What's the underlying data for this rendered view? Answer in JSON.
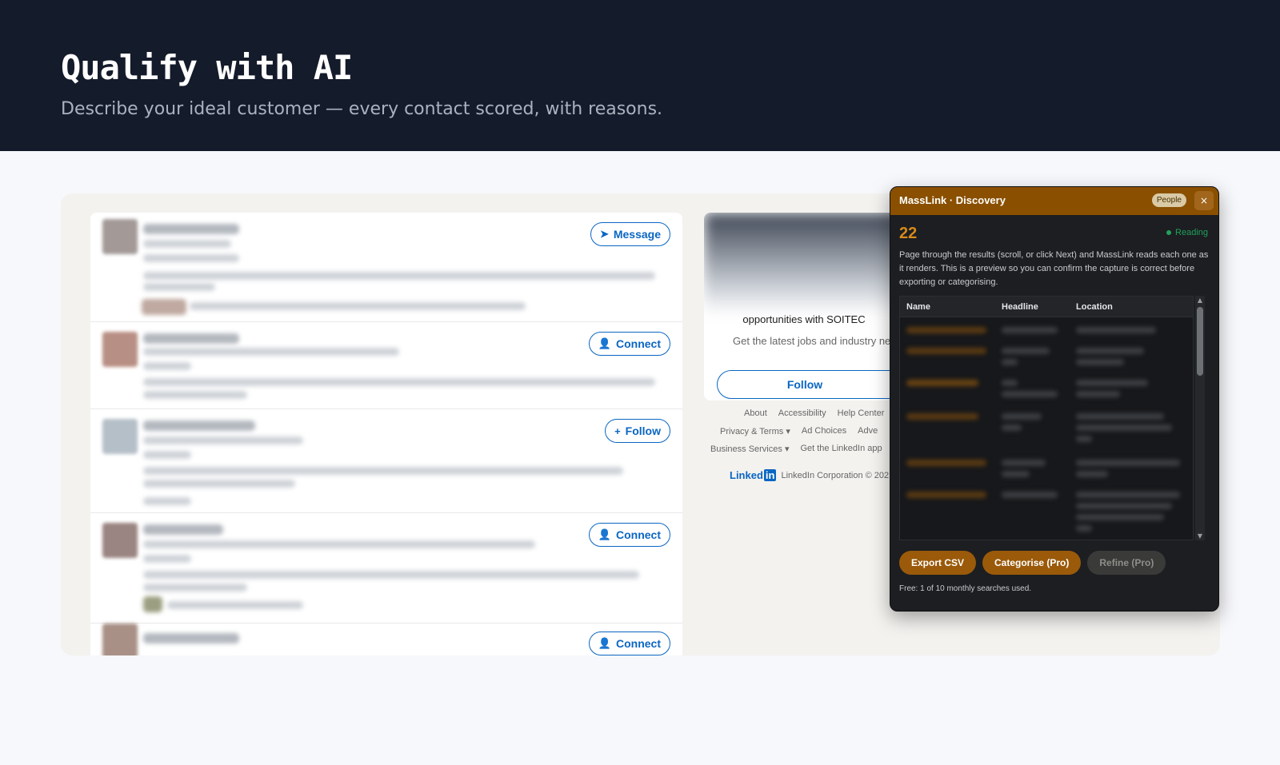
{
  "hero": {
    "title": "Qualify with AI",
    "subtitle": "Describe your ideal customer — every contact scored, with reasons."
  },
  "feed": {
    "rows": [
      {
        "action_label": "Message",
        "action_icon": "send-icon"
      },
      {
        "action_label": "Connect",
        "action_icon": "add-person-icon"
      },
      {
        "action_label": "Follow",
        "action_icon": "plus-icon"
      },
      {
        "action_label": "Connect",
        "action_icon": "add-person-icon"
      },
      {
        "action_label": "Connect",
        "action_icon": "add-person-icon"
      }
    ]
  },
  "company_card": {
    "headline": "opportunities with SOITEC",
    "tagline": "Get the latest jobs and industry ne",
    "follow_label": "Follow"
  },
  "footer": {
    "links_row1": [
      "About",
      "Accessibility",
      "Help Center"
    ],
    "links_row2": [
      "Privacy & Terms",
      "Ad Choices",
      "Adve"
    ],
    "links_row3": [
      "Business Services",
      "Get the LinkedIn app"
    ],
    "logo_text": "Linked",
    "logo_box": "in",
    "copyright": "LinkedIn Corporation © 202"
  },
  "panel": {
    "title": "MassLink · Discovery",
    "badge": "People",
    "close_glyph": "×",
    "count": "22",
    "status": "Reading",
    "description": "Page through the results (scroll, or click Next) and MassLink reads each one as it renders. This is a preview so you can confirm the capture is correct before exporting or categorising.",
    "columns": [
      "Name",
      "Headline",
      "Location"
    ],
    "buttons": {
      "export": "Export CSV",
      "categorise": "Categorise (Pro)",
      "refine": "Refine (Pro)"
    },
    "quota": "Free: 1 of 10 monthly searches used."
  },
  "colors": {
    "hero_bg": "#141b2a",
    "linkedin_blue": "#0a66c2",
    "panel_accent": "#8a5000",
    "status_green": "#22a35c"
  }
}
